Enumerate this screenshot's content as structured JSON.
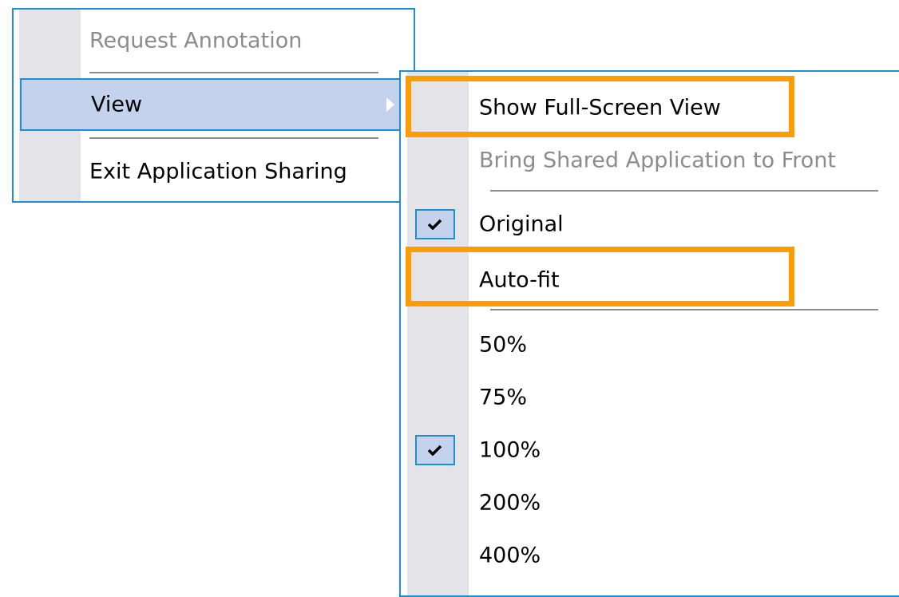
{
  "main_menu": {
    "items": [
      {
        "label": "Request Annotation",
        "state": "disabled"
      },
      {
        "label": "View",
        "state": "highlighted",
        "has_submenu": true
      },
      {
        "label": "Exit Application Sharing",
        "state": "enabled"
      }
    ]
  },
  "view_submenu": {
    "items": [
      {
        "label": "Show Full-Screen View",
        "state": "enabled",
        "callout": true
      },
      {
        "label": "Bring Shared Application to Front",
        "state": "disabled"
      },
      {
        "label": "Original",
        "checked": true
      },
      {
        "label": "Auto-fit",
        "checked": false,
        "callout": true
      },
      {
        "label": "50%",
        "checked": false
      },
      {
        "label": "75%",
        "checked": false
      },
      {
        "label": "100%",
        "checked": true
      },
      {
        "label": "200%",
        "checked": false
      },
      {
        "label": "400%",
        "checked": false
      }
    ]
  },
  "colors": {
    "menu_border": "#1f8fd0",
    "highlight_fill": "#c4d2ee",
    "gutter": "#e4e4e8",
    "callout": "#ff9c00",
    "disabled_text": "#8c8c8c"
  },
  "icons": {
    "submenu_arrow": "chevron-right-icon",
    "check": "checkmark-icon"
  }
}
